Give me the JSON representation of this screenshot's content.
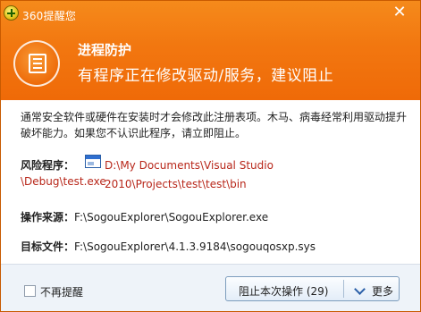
{
  "window": {
    "title": "360提醒您",
    "close_glyph": "✕"
  },
  "header": {
    "heading": "进程防护",
    "message": "有程序正在修改驱动/服务，建议阻止"
  },
  "description": "通常安全软件或硬件在安装时才会修改此注册表项。木马、病毒经常利用驱动提升破坏能力。如果您不认识此程序，请立即阻止。",
  "details": {
    "risk_label": "风险程序：",
    "risk_path_line1": "D:\\My Documents\\Visual Studio 2010\\Projects\\test\\test\\bin",
    "risk_path_line2": "\\Debug\\test.exe",
    "source_label": "操作来源：",
    "source_value": "F:\\SogouExplorer\\SogouExplorer.exe",
    "target_label": "目标文件：",
    "target_value": "F:\\SogouExplorer\\4.1.3.9184\\sogouqosxp.sys"
  },
  "footer": {
    "no_remind_label": "不再提醒",
    "block_button_label": "阻止本次操作 (29)",
    "more_label": "更多"
  },
  "colors": {
    "header_orange": "#f27710",
    "path_red": "#b8271a",
    "footer_bg": "#eef3f9"
  }
}
